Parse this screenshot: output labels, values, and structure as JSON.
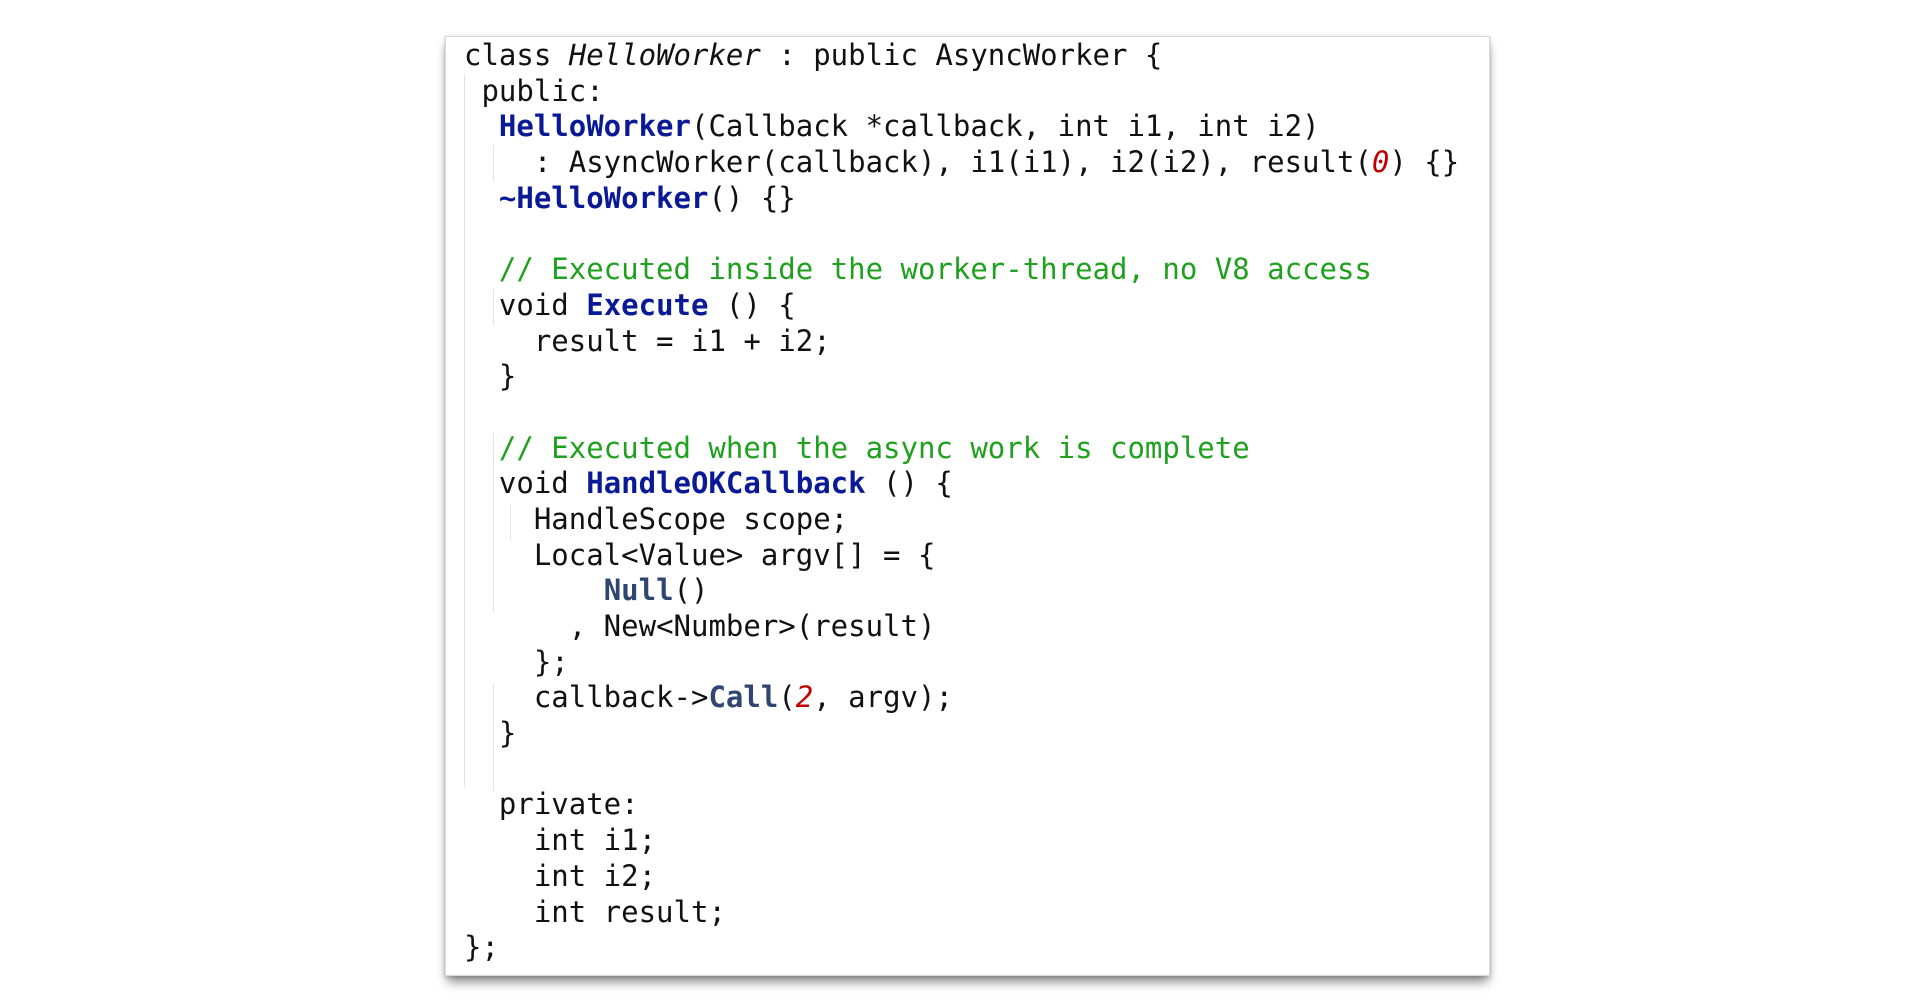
{
  "code": {
    "class_kw": "class ",
    "class_name": "HelloWorker",
    "class_rest": " : public AsyncWorker {",
    "public_label": "public:",
    "ctor_indent": "  ",
    "ctor_name": "HelloWorker",
    "ctor_params": "(Callback *callback, int i1, int i2)",
    "init_indent": "    ",
    "init_list": ": AsyncWorker(callback), i1(i1), i2(i2), result(",
    "init_zero": "0",
    "init_end": ") {}",
    "dtor_indent": "  ",
    "dtor_name": "~HelloWorker",
    "dtor_rest": "() {}",
    "comment_execute": "// Executed inside the worker-thread, no V8 access",
    "execute_kw": "void ",
    "execute_name": "Execute",
    "execute_rest": " () {",
    "execute_body": "result = i1 + i2;",
    "close_brace": "}",
    "comment_callback": "// Executed when the async work is complete",
    "callback_kw": "void ",
    "callback_name": "HandleOKCallback",
    "callback_rest": " () {",
    "scope_line": "HandleScope scope;",
    "argv_line": "Local<Value> argv[] = {",
    "null_name": "Null",
    "null_rest": "()",
    "new_line": ", New<Number>(result)",
    "argv_close": "};",
    "call_prefix": "callback->",
    "call_name": "Call",
    "call_open": "(",
    "call_num": "2",
    "call_rest": ", argv);",
    "private_label": "private:",
    "field_i1": "int i1;",
    "field_i2": "int i2;",
    "field_result": "int result;",
    "class_close": "};"
  }
}
